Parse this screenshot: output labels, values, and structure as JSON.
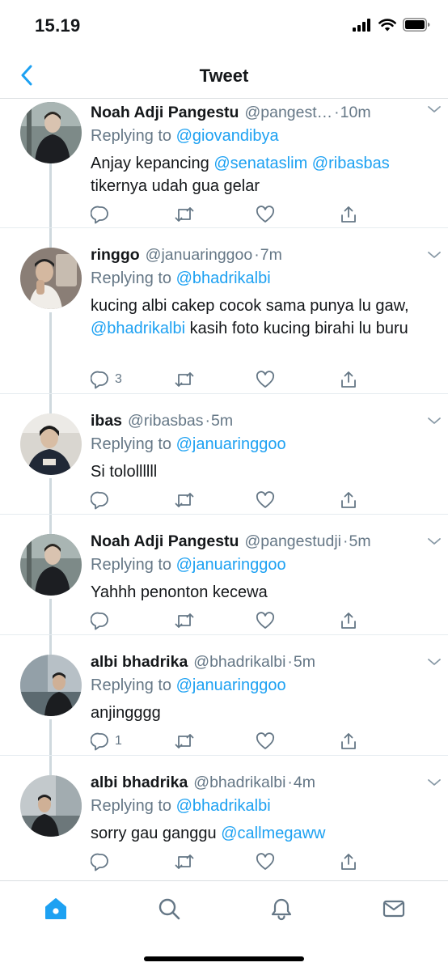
{
  "status_bar": {
    "time": "15.19"
  },
  "nav": {
    "title": "Tweet"
  },
  "tweets": [
    {
      "name": "Noah Adji Pangestu",
      "handle": "@pangest…",
      "time": "10m",
      "replying_prefix": "Replying to",
      "replying_to": "@giovandibya",
      "text_parts": [
        {
          "t": "Anjay kepancing ",
          "link": false
        },
        {
          "t": "@senataslim",
          "link": true
        },
        {
          "t": " ",
          "link": false
        },
        {
          "t": "@ribasbas",
          "link": true
        },
        {
          "t": " tikernya udah gua gelar",
          "link": false
        }
      ],
      "reply_count": ""
    },
    {
      "name": "ringgo",
      "handle": "@januaringgoo",
      "time": "7m",
      "replying_prefix": "Replying to",
      "replying_to": "@bhadrikalbi",
      "text_parts": [
        {
          "t": "kucing albi cakep cocok sama punya lu gaw, ",
          "link": false
        },
        {
          "t": "@bhadrikalbi",
          "link": true
        },
        {
          "t": " kasih foto kucing birahi lu buru",
          "link": false
        }
      ],
      "reply_count": "3"
    },
    {
      "name": "ibas",
      "handle": "@ribasbas",
      "time": "5m",
      "replying_prefix": "Replying to",
      "replying_to": "@januaringgoo",
      "text_parts": [
        {
          "t": "Si tolollllll",
          "link": false
        }
      ],
      "reply_count": ""
    },
    {
      "name": "Noah Adji Pangestu",
      "handle": "@pangestudji",
      "time": "5m",
      "replying_prefix": "Replying to",
      "replying_to": "@januaringgoo",
      "text_parts": [
        {
          "t": "Yahhh penonton kecewa",
          "link": false
        }
      ],
      "reply_count": ""
    },
    {
      "name": "albi bhadrika",
      "handle": "@bhadrikalbi",
      "time": "5m",
      "replying_prefix": "Replying to",
      "replying_to": "@januaringgoo",
      "text_parts": [
        {
          "t": "anjingggg",
          "link": false
        }
      ],
      "reply_count": "1"
    },
    {
      "name": "albi bhadrika",
      "handle": "@bhadrikalbi",
      "time": "4m",
      "replying_prefix": "Replying to",
      "replying_to": "@bhadrikalbi",
      "text_parts": [
        {
          "t": "sorry gau ganggu ",
          "link": false
        },
        {
          "t": "@callmegaww",
          "link": true
        }
      ],
      "reply_count": ""
    }
  ],
  "tab_bar": {
    "items": [
      {
        "icon": "home-icon",
        "active": true
      },
      {
        "icon": "search-icon",
        "active": false
      },
      {
        "icon": "bell-icon",
        "active": false
      },
      {
        "icon": "mail-icon",
        "active": false
      }
    ]
  },
  "colors": {
    "accent": "#1da1f2",
    "secondary_text": "#657786",
    "icon_gray": "#657786",
    "thread_line": "#cfd9de"
  }
}
